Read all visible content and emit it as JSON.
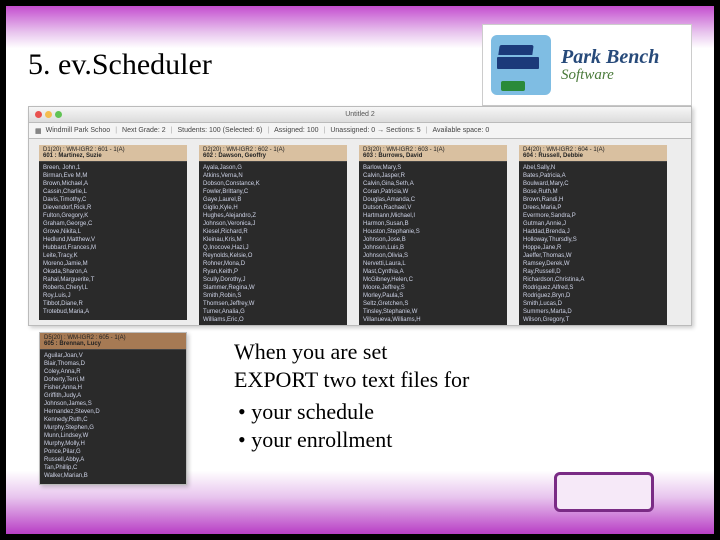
{
  "heading": "5. ev.Scheduler",
  "logo": {
    "line1": "Park Bench",
    "line2": "Software"
  },
  "window": {
    "title": "Untitled 2",
    "toolbar": {
      "school": "Windmill Park Schoo",
      "gradeLabel": "Next Grade:",
      "gradeValue": "2",
      "studentsLabel": "Students:",
      "studentsValue": "100 (Selected: 6)",
      "assignedLabel": "Assigned:",
      "assignedValue": "100",
      "unassignedLabel": "Unassigned:",
      "unassignedValue": "0",
      "sectionsLabel": "Sections:",
      "sectionsValue": "5",
      "spaceLabel": "Available space:",
      "spaceValue": "0"
    },
    "panels": [
      {
        "head": "D1(20) : WM-IGR2 : 601 - 1(A)",
        "teacher": "601 : Martinez, Suzie",
        "students": [
          "Breen, John,1",
          "Birman,Eve M,M",
          "Brown,Michael,A",
          "Cassin,Charlie,L",
          "Davis,Timothy,C",
          "Dievendorf,Rick,R",
          "Fulton,Gregory,K",
          "Graham,George,C",
          "Grove,Nikita,L",
          "Hedlund,Matthew,V",
          "Hubbard,Frances,M",
          "Leite,Tracy,K",
          "Moreno,Jamie,M",
          "Okada,Sharon,A",
          "Rahal,Marguerite,T",
          "Roberts,Cheryl,L",
          "Roy,Luis,J",
          "Tibbot,Diane,R",
          "Trotebud,Maria,A"
        ]
      },
      {
        "head": "D2(20) : WM-IGR2 : 602 - 1(A)",
        "teacher": "602 : Dawson, Geoffry",
        "students": [
          "Ayala,Jason,G",
          "Atkins,Verna,N",
          "Dobson,Constance,K",
          "Fowler,Brittany,C",
          "Gaye,Laurel,B",
          "Giglio,Kyle,H",
          "Hughes,Alejandro,Z",
          "Johnson,Veronica,J",
          "Kiesel,Richard,R",
          "Kleinau,Kris,M",
          "Q,Inocove,Hazi,J",
          "Reynolds,Kelsie,O",
          "Rohner,Mona,D",
          "Ryan,Keith,P",
          "Scully,Dorothy,J",
          "Slammer,Regina,W",
          "Smith,Robin,S",
          "Thomsen,Jeffrey,W",
          "Turner,Analia,G",
          "Williams,Eric,O"
        ]
      },
      {
        "head": "D3(20) : WM-IGR2 : 603 - 1(A)",
        "teacher": "603 : Burrows, David",
        "students": [
          "Barlow,Mary,S",
          "Calvin,Jasper,R",
          "Calvin,Gina,Seth,A",
          "Coran,Patricia,W",
          "Douglas,Amanda,C",
          "Dutson,Rachael,V",
          "Hartmann,Michael,I",
          "Harmon,Susan,B",
          "Houston,Stephanie,S",
          "Johnson,Jose,B",
          "Johnson,Luis,B",
          "Johnson,Olivia,S",
          "Nervetti,Laura,L",
          "Mast,Cynthia,A",
          "McGibney,Helen,C",
          "Moore,Jeffrey,S",
          "Morley,Paula,S",
          "Seltz,Gretchen,S",
          "Tinsley,Stephanie,W",
          "Villanueva,Williams,H"
        ]
      },
      {
        "head": "D4(20) : WM-IGR2 : 604 - 1(A)",
        "teacher": "604 : Russell, Debbie",
        "students": [
          "Abel,Sally,N",
          "Bates,Patricia,A",
          "Boulward,Mary,C",
          "Bose,Ruth,M",
          "Brown,Randi,H",
          "Drees,Maria,P",
          "Evermore,Sandra,P",
          "Gutman,Annie,J",
          "Haddad,Brenda,J",
          "Holloway,Thursdly,S",
          "Hoppe,Jane,R",
          "Jaeffer,Thomas,W",
          "Ramsey,Derek,W",
          "Ray,Russell,D",
          "Richardson,Christina,A",
          "Rodriguez,Alfred,S",
          "Rodriguez,Bryn,D",
          "Smith,Lucas,D",
          "Summers,Marta,D",
          "Wilson,Gregory,T"
        ]
      }
    ],
    "panel5": {
      "head": "D5(20) : WM-IGR2 : 605 - 1(A)",
      "teacher": "605 : Brennan, Lucy",
      "students": [
        "Aguilar,Joan,V",
        "Blair,Thomas,D",
        "Coley,Anna,R",
        "Doherty,Terri,M",
        "Fisher,Anna,H",
        "Griffith,Judy,A",
        "Johnson,James,S",
        "Hernandez,Steven,D",
        "Kennedy,Ruth,C",
        "Murphy,Stephen,G",
        "Munn,Lindsey,W",
        "Murphy,Molly,H",
        "Ponce,Pilar,G",
        "Russell,Abby,A",
        "Tan,Phillip,C",
        "Walker,Marian,B"
      ]
    }
  },
  "instruction": {
    "line1": "When you are set",
    "line2": "EXPORT two text files for",
    "b1": "your schedule",
    "b2": "your enrollment"
  }
}
